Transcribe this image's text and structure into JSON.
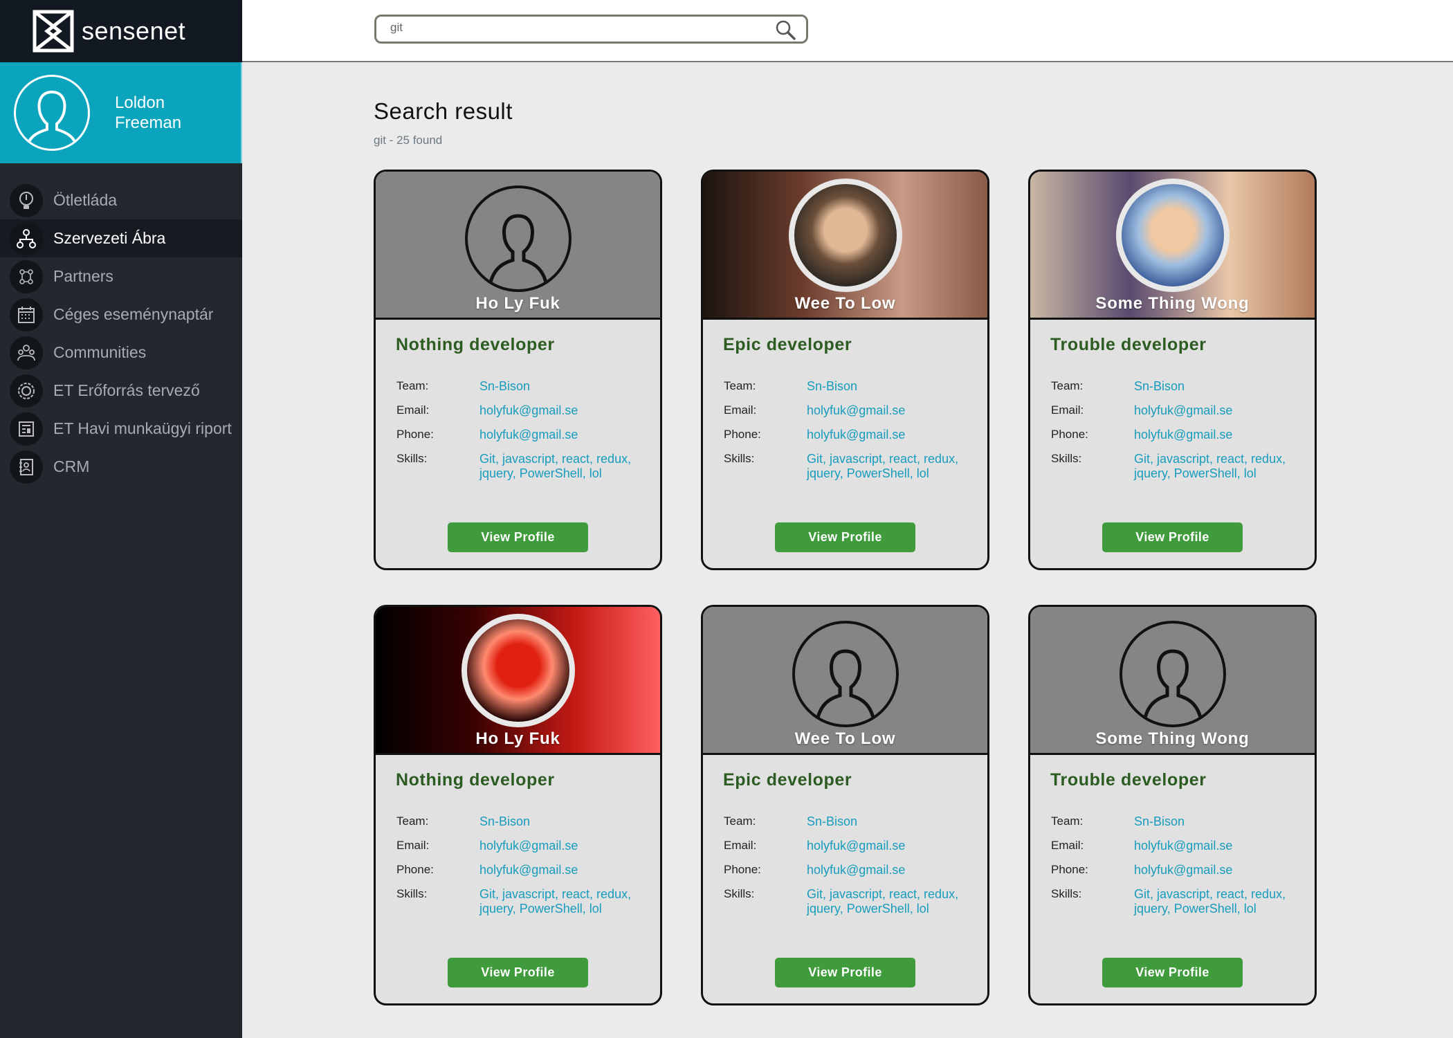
{
  "app": {
    "logo_text": "sensenet"
  },
  "user": {
    "first_name": "Loldon",
    "last_name": "Freeman"
  },
  "menu": [
    {
      "label": "Ötletláda",
      "icon": "lightbulb-icon"
    },
    {
      "label": "Szervezeti Ábra",
      "icon": "org-chart-icon",
      "active": true
    },
    {
      "label": "Partners",
      "icon": "partners-icon"
    },
    {
      "label": "Céges eseménynaptár",
      "icon": "calendar-icon"
    },
    {
      "label": "Communities",
      "icon": "communities-icon"
    },
    {
      "label": "ET Erőforrás tervező",
      "icon": "resource-planner-icon"
    },
    {
      "label": "ET Havi munkaügyi riport",
      "icon": "report-icon"
    },
    {
      "label": "CRM",
      "icon": "crm-icon"
    }
  ],
  "search": {
    "value": "git"
  },
  "results": {
    "title": "Search result",
    "subtitle": "git - 25 found"
  },
  "labels": {
    "team": "Team:",
    "email": "Email:",
    "phone": "Phone:",
    "skills": "Skills:",
    "view_profile": "View Profile"
  },
  "cards": [
    {
      "name": "Ho Ly Fuk",
      "role": "Nothing developer",
      "team": "Sn-Bison",
      "email": "holyfuk@gmail.se",
      "phone": "holyfuk@gmail.se",
      "skills": "Git, javascript, react, redux, jquery, PowerShell, lol",
      "avatar": "default-avatar-icon"
    },
    {
      "name": "Wee To Low",
      "role": "Epic developer",
      "team": "Sn-Bison",
      "email": "holyfuk@gmail.se",
      "phone": "holyfuk@gmail.se",
      "skills": "Git, javascript, react, redux, jquery, PowerShell, lol",
      "avatar": "photo"
    },
    {
      "name": "Some Thing Wong",
      "role": "Trouble developer",
      "team": "Sn-Bison",
      "email": "holyfuk@gmail.se",
      "phone": "holyfuk@gmail.se",
      "skills": "Git, javascript, react, redux, jquery, PowerShell, lol",
      "avatar": "photo"
    },
    {
      "name": "Ho Ly Fuk",
      "role": "Nothing developer",
      "team": "Sn-Bison",
      "email": "holyfuk@gmail.se",
      "phone": "holyfuk@gmail.se",
      "skills": "Git, javascript, react, redux, jquery, PowerShell, lol",
      "avatar": "photo"
    },
    {
      "name": "Wee To Low",
      "role": "Epic developer",
      "team": "Sn-Bison",
      "email": "holyfuk@gmail.se",
      "phone": "holyfuk@gmail.se",
      "skills": "Git, javascript, react, redux, jquery, PowerShell, lol",
      "avatar": "default-avatar-icon"
    },
    {
      "name": "Some Thing Wong",
      "role": "Trouble developer",
      "team": "Sn-Bison",
      "email": "holyfuk@gmail.se",
      "phone": "holyfuk@gmail.se",
      "skills": "Git, javascript, react, redux, jquery, PowerShell, lol",
      "avatar": "default-avatar-icon"
    }
  ],
  "colors": {
    "accent": "#0ba4bd",
    "button": "#3f9b3c",
    "role": "#2d5c23",
    "link": "#179cbd",
    "sidebar": "#23272e"
  }
}
